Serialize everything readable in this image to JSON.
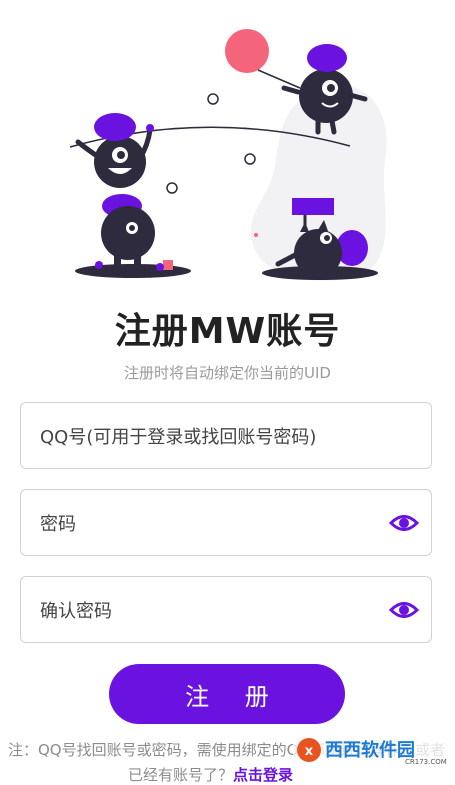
{
  "page": {
    "title": "注册MW账号",
    "subtitle": "注册时将自动绑定你当前的UID"
  },
  "form": {
    "qq_placeholder": "QQ号(可用于登录或找回账号密码)",
    "password_placeholder": "密码",
    "confirm_placeholder": "确认密码"
  },
  "actions": {
    "register_label": "注 册"
  },
  "footer": {
    "note_line1": "注：QQ号找回账号或密码，需使用绑定的QQ邮箱进行操作，或者",
    "note_line2_prefix": "已经有账号了？",
    "login_link": "点击登录"
  },
  "watermark": {
    "brand": "西西软件园",
    "site": "CR173.COM"
  },
  "colors": {
    "accent": "#6a12e0",
    "monster": "#2d2b3d",
    "balloon": "#f4647a"
  }
}
